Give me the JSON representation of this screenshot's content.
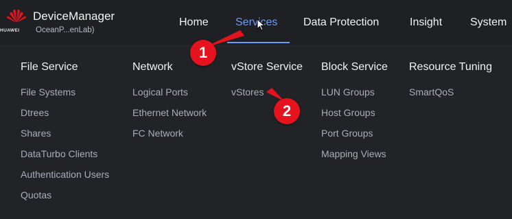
{
  "brand": {
    "logo_word": "HUAWEI"
  },
  "app": {
    "title": "DeviceManager",
    "subtitle": "OceanP...enLab)"
  },
  "nav": {
    "items": [
      {
        "label": "Home"
      },
      {
        "label": "Services"
      },
      {
        "label": "Data Protection"
      },
      {
        "label": "Insight"
      },
      {
        "label": "System"
      }
    ],
    "active_color": "#6e9bf5"
  },
  "menu": {
    "columns": [
      {
        "title": "File Service",
        "items": [
          "File Systems",
          "Dtrees",
          "Shares",
          "DataTurbo Clients",
          "Authentication Users",
          "Quotas"
        ]
      },
      {
        "title": "Network",
        "items": [
          "Logical Ports",
          "Ethernet Network",
          "FC Network"
        ]
      },
      {
        "title": "vStore Service",
        "items": [
          "vStores"
        ]
      },
      {
        "title": "Block Service",
        "items": [
          "LUN Groups",
          "Host Groups",
          "Port Groups",
          "Mapping Views"
        ]
      },
      {
        "title": "Resource Tuning",
        "items": [
          "SmartQoS"
        ]
      }
    ]
  },
  "annotations": {
    "step1": "1",
    "step2": "2",
    "color": "#e5131d"
  }
}
